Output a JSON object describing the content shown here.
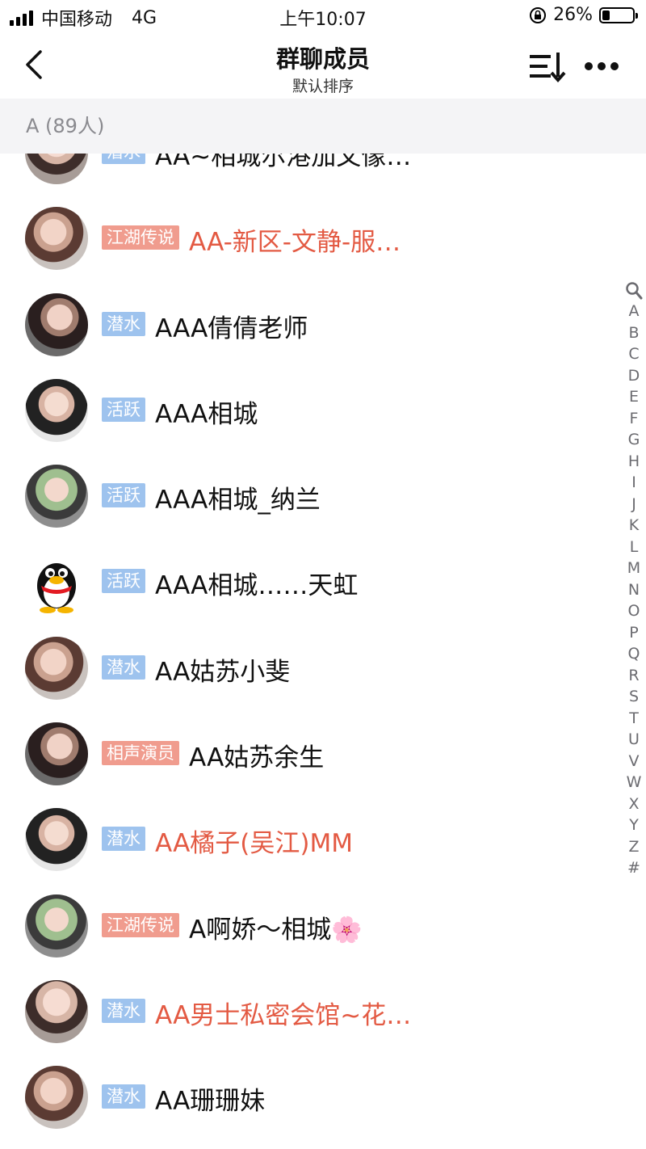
{
  "status": {
    "carrier": "中国移动",
    "network": "4G",
    "time": "上午10:07",
    "battery": "26%",
    "battery_level": 0.26
  },
  "nav": {
    "title": "群聊成员",
    "subtitle": "默认排序"
  },
  "section": {
    "label": "A (89人)"
  },
  "members": [
    {
      "tag": "潜水",
      "tag_color": "#9ec3ee",
      "name": "AA~相城尔港加文像…",
      "name_color": "#111111",
      "avatar": "photo"
    },
    {
      "tag": "江湖传说",
      "tag_color": "#f09c8e",
      "name": "AA-新区-文静-服…",
      "name_color": "#e35a43",
      "avatar": "photo"
    },
    {
      "tag": "潜水",
      "tag_color": "#9ec3ee",
      "name": "AAA倩倩老师",
      "name_color": "#111111",
      "avatar": "photo"
    },
    {
      "tag": "活跃",
      "tag_color": "#9ec3ee",
      "name": "AAA相城",
      "name_color": "#111111",
      "avatar": "photo"
    },
    {
      "tag": "活跃",
      "tag_color": "#9ec3ee",
      "name": "AAA相城_纳兰",
      "name_color": "#111111",
      "avatar": "photo"
    },
    {
      "tag": "活跃",
      "tag_color": "#9ec3ee",
      "name": "AAA相城……天虹",
      "name_color": "#111111",
      "avatar": "penguin"
    },
    {
      "tag": "潜水",
      "tag_color": "#9ec3ee",
      "name": "AA姑苏小斐",
      "name_color": "#111111",
      "avatar": "photo"
    },
    {
      "tag": "相声演员",
      "tag_color": "#f09c8e",
      "name": "AA姑苏余生",
      "name_color": "#111111",
      "avatar": "photo"
    },
    {
      "tag": "潜水",
      "tag_color": "#9ec3ee",
      "name": "AA橘子(吴江)MM",
      "name_color": "#e35a43",
      "avatar": "photo"
    },
    {
      "tag": "江湖传说",
      "tag_color": "#f09c8e",
      "name": "A啊娇～相城🌸",
      "name_color": "#111111",
      "avatar": "photo"
    },
    {
      "tag": "潜水",
      "tag_color": "#9ec3ee",
      "name": "AA男士私密会馆~花…",
      "name_color": "#e35a43",
      "avatar": "photo"
    },
    {
      "tag": "潜水",
      "tag_color": "#9ec3ee",
      "name": "AA珊珊妹",
      "name_color": "#111111",
      "avatar": "photo"
    }
  ],
  "index_letters": [
    "A",
    "B",
    "C",
    "D",
    "E",
    "F",
    "G",
    "H",
    "I",
    "J",
    "K",
    "L",
    "M",
    "N",
    "O",
    "P",
    "Q",
    "R",
    "S",
    "T",
    "U",
    "V",
    "W",
    "X",
    "Y",
    "Z",
    "#"
  ]
}
